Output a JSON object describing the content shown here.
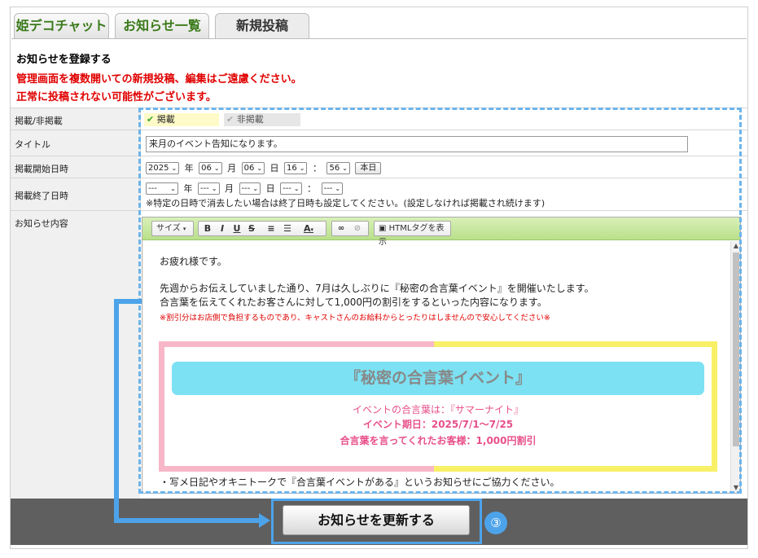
{
  "tabs": [
    {
      "label": "姫デコチャット"
    },
    {
      "label": "お知らせ一覧"
    },
    {
      "label": "新規投稿"
    }
  ],
  "messages": {
    "heading": "お知らせを登録する",
    "warn1": "管理画面を複数開いての新規投稿、編集はご遠慮ください。",
    "warn2": "正常に投稿されない可能性がございます。"
  },
  "form": {
    "publish": {
      "label": "掲載/非掲載",
      "on": "掲載",
      "off": "非掲載"
    },
    "title": {
      "label": "タイトル",
      "value": "来月のイベント告知になります。"
    },
    "start": {
      "label": "掲載開始日時",
      "year": "2025",
      "month": "06",
      "day": "06",
      "hour": "16",
      "minute": "56",
      "unit_year": "年",
      "unit_month": "月",
      "unit_day": "日",
      "colon": "：",
      "today": "本日"
    },
    "end": {
      "label": "掲載終了日時",
      "year": "---",
      "month": "---",
      "day": "---",
      "hour": "---",
      "minute": "---",
      "note": "※特定の日時で消去したい場合は終了日時も設定してください。(設定しなければ掲載され続けます)"
    },
    "content": {
      "label": "お知らせ内容"
    }
  },
  "toolbar": {
    "size": "サイズ",
    "bold": "B",
    "italic": "I",
    "underline": "U",
    "strike": "S",
    "html": "HTMLタグを表示"
  },
  "body": {
    "greeting": "お疲れ様です。",
    "p1": "先週からお伝えしていました通り、7月は久しぶりに『秘密の合言葉イベント』を開催いたします。",
    "p2": "合言葉を伝えてくれたお客さんに対して1,000円の割引をするといった内容になります。",
    "note": "※割引分はお店側で負担するものであり、キャストさんのお給料からとったりはしませんので安心してください※",
    "banner_title": "『秘密の合言葉イベント』",
    "banner_l1": "イベントの合言葉は：『サマーナイト』",
    "banner_l2": "イベント期日：2025/7/1～7/25",
    "banner_l3": "合言葉を言ってくれたお客様：1,000円割引",
    "p3": "・写メ日記やオキニトークで『合言葉イベントがある』というお知らせにご協力ください。"
  },
  "submit": {
    "label": "お知らせを更新する"
  },
  "marker": "③",
  "colors": {
    "highlight": "#4da3ea",
    "warning": "#e00000",
    "toolbar": "#c8e8a0",
    "banner_pink": "#f7b7c9",
    "banner_yellow": "#f8f067",
    "banner_title_bg": "#7ce1f2"
  }
}
